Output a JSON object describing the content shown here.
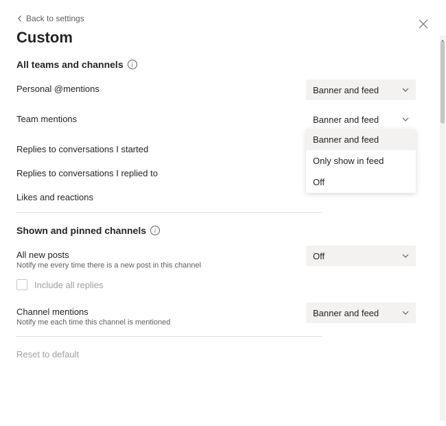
{
  "header": {
    "back_label": "Back to settings",
    "page_title": "Custom"
  },
  "section1": {
    "title": "All teams and channels",
    "rows": [
      {
        "label": "Personal @mentions",
        "value": "Banner and feed"
      },
      {
        "label": "Team mentions",
        "value": "Banner and feed"
      },
      {
        "label": "Replies to conversations I started",
        "value": ""
      },
      {
        "label": "Replies to conversations I replied to",
        "value": ""
      },
      {
        "label": "Likes and reactions",
        "value": ""
      }
    ],
    "dropdown_options": [
      "Banner and feed",
      "Only show in feed",
      "Off"
    ]
  },
  "section2": {
    "title": "Shown and pinned channels",
    "rows": {
      "all_new_posts": {
        "label": "All new posts",
        "sublabel": "Notify me every time there is a new post in this channel",
        "value": "Off"
      },
      "include_replies": {
        "label": "Include all replies",
        "checked": false
      },
      "channel_mentions": {
        "label": "Channel mentions",
        "sublabel": "Notify me each time this channel is mentioned",
        "value": "Banner and feed"
      }
    }
  },
  "reset_label": "Reset to default"
}
